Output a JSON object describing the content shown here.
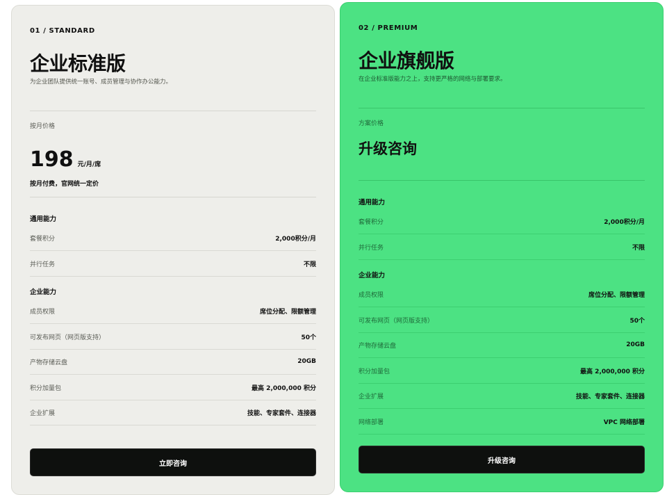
{
  "standard": {
    "eyebrow": "01 / STANDARD",
    "title": "企业标准版",
    "subtitle": "为企业团队提供统一账号、成员管理与协作办公能力。",
    "price_label": "按月价格",
    "price": "198",
    "price_unit": "元/月/席",
    "price_note": "按月付费，官网统一定价",
    "sections": [
      {
        "title": "通用能力",
        "rows": [
          {
            "k": "套餐积分",
            "v": "2,000积分/月"
          },
          {
            "k": "并行任务",
            "v": "不限"
          }
        ]
      },
      {
        "title": "企业能力",
        "rows": [
          {
            "k": "成员权限",
            "v": "席位分配、限额管理"
          },
          {
            "k": "可发布网页（网页版支持）",
            "v": "50个"
          },
          {
            "k": "产物存储云盘",
            "v": "20GB"
          },
          {
            "k": "积分加量包",
            "v": "最高 2,000,000 积分"
          },
          {
            "k": "企业扩展",
            "v": "技能、专家套件、连接器"
          }
        ]
      }
    ],
    "cta": "立即咨询"
  },
  "premium": {
    "eyebrow": "02 / PREMIUM",
    "title": "企业旗舰版",
    "subtitle": "在企业标准版能力之上，支持更严格的网络与部署要求。",
    "price_label": "方案价格",
    "price_text": "升级咨询",
    "sections": [
      {
        "title": "通用能力",
        "rows": [
          {
            "k": "套餐积分",
            "v": "2,000积分/月"
          },
          {
            "k": "并行任务",
            "v": "不限"
          }
        ]
      },
      {
        "title": "企业能力",
        "rows": [
          {
            "k": "成员权限",
            "v": "席位分配、限额管理"
          },
          {
            "k": "可发布网页（网页版支持）",
            "v": "50个"
          },
          {
            "k": "产物存储云盘",
            "v": "20GB"
          },
          {
            "k": "积分加量包",
            "v": "最高 2,000,000 积分"
          },
          {
            "k": "企业扩展",
            "v": "技能、专家套件、连接器"
          },
          {
            "k": "网络部署",
            "v": "VPC 网络部署"
          }
        ]
      }
    ],
    "cta": "升级咨询"
  },
  "colors": {
    "standard_bg": "#eeeeea",
    "premium_bg": "#4ce283",
    "button_bg": "#0e100e"
  }
}
